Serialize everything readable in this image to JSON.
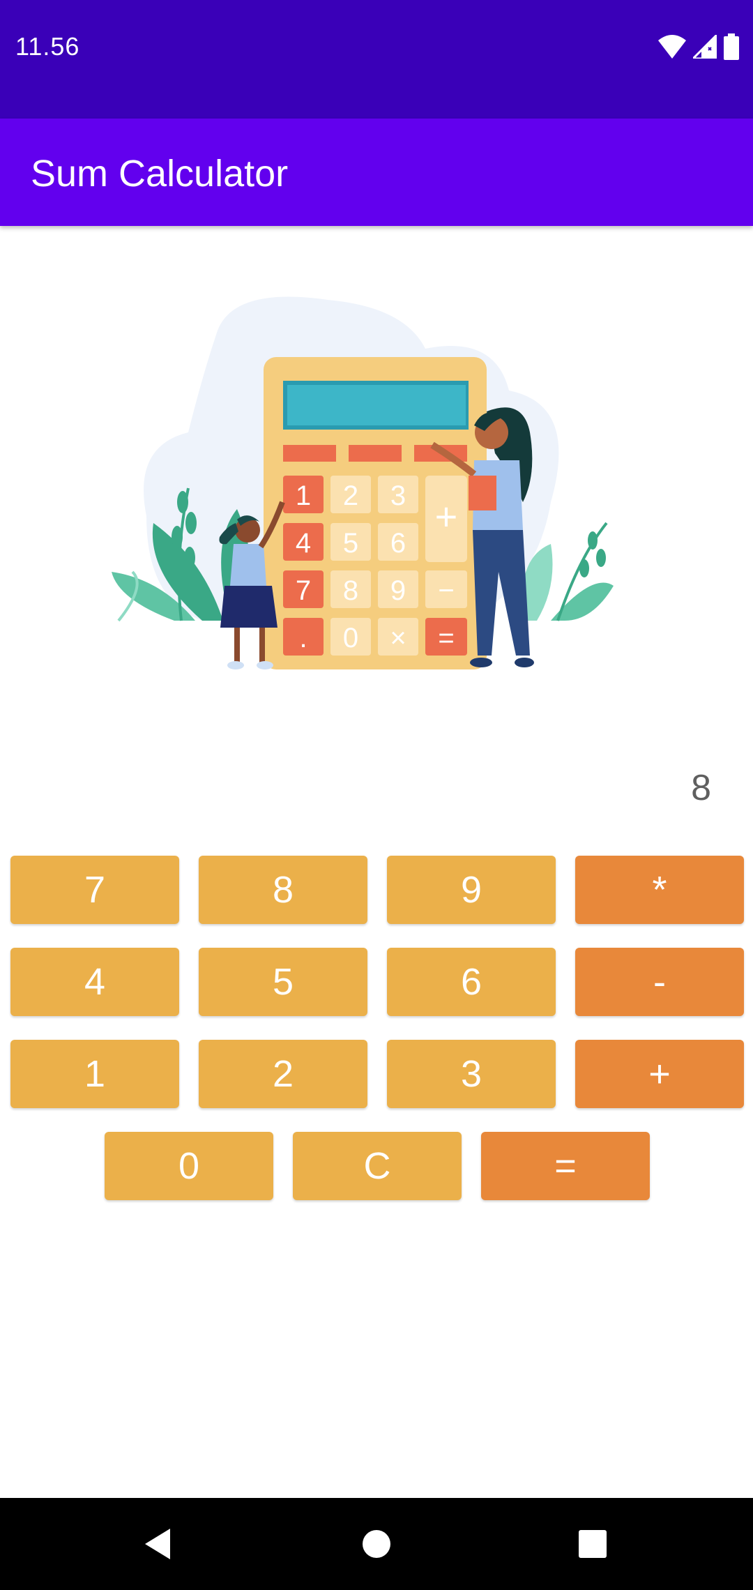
{
  "status_bar": {
    "time": "11.56",
    "icons": [
      "wifi-icon",
      "signal-icon",
      "battery-icon"
    ]
  },
  "app_bar": {
    "title": "Sum Calculator"
  },
  "display": {
    "value": "8"
  },
  "keypad": {
    "row1": [
      "7",
      "8",
      "9",
      "*"
    ],
    "row2": [
      "4",
      "5",
      "6",
      "-"
    ],
    "row3": [
      "1",
      "2",
      "3",
      "+"
    ],
    "row4": [
      "0",
      "C",
      "="
    ]
  },
  "illustration": {
    "calc_keys": [
      "1",
      "2",
      "3",
      "4",
      "5",
      "6",
      "7",
      "8",
      "9",
      ".",
      "0",
      "×",
      "+",
      "−",
      "="
    ]
  },
  "colors": {
    "status_bar": "#3a00b8",
    "app_bar": "#6200ee",
    "number_button": "#ebb04a",
    "operator_button": "#e8883a"
  },
  "nav_bar": {
    "icons": [
      "back-icon",
      "home-icon",
      "recents-icon"
    ]
  }
}
